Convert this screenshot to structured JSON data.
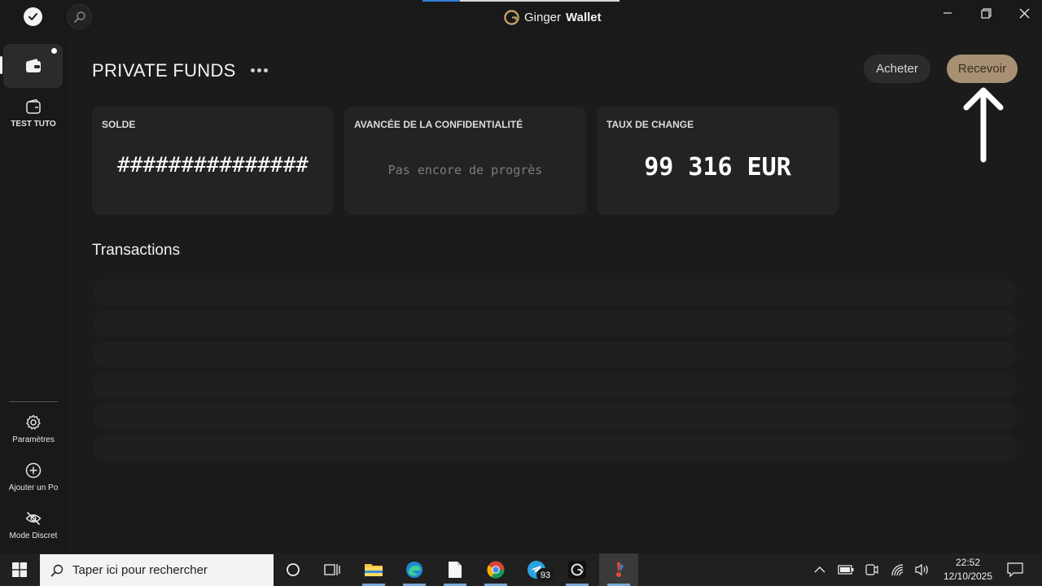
{
  "titlebar": {
    "brand_prefix": "Ginger",
    "brand_suffix": "Wallet",
    "loading_progress": 0.19
  },
  "sidebar": {
    "items": [
      {
        "label": "TEST TUTO",
        "icon": "wallet-icon"
      },
      {
        "label": "Paramètres",
        "icon": "gear-icon"
      },
      {
        "label": "Ajouter un Po",
        "icon": "add-circle-icon"
      },
      {
        "label": "Mode Discret",
        "icon": "eye-off-icon"
      }
    ]
  },
  "main": {
    "title": "PRIVATE FUNDS",
    "buy_label": "Acheter",
    "receive_label": "Recevoir",
    "tiles": [
      {
        "title": "SOLDE",
        "value": "###############"
      },
      {
        "title": "AVANCÉE DE LA CONFIDENTIALITÉ",
        "value": "Pas encore de progrès"
      },
      {
        "title": "TAUX DE CHANGE",
        "value": "99 316 EUR"
      }
    ],
    "transactions_title": "Transactions"
  },
  "taskbar": {
    "search_placeholder": "Taper ici pour rechercher",
    "telegram_badge": "93",
    "time": "22:52",
    "date": "12/10/2025"
  },
  "colors": {
    "accent": "#a89172",
    "background": "#1b1b1b",
    "card": "#232323"
  }
}
